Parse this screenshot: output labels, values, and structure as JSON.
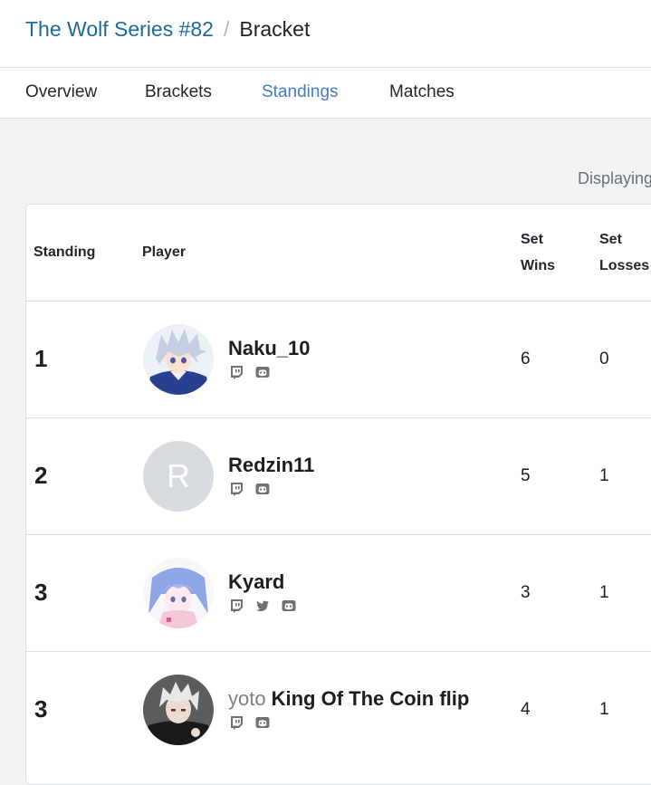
{
  "breadcrumb": {
    "tournament": "The Wolf Series #82",
    "separator": "/",
    "current": "Bracket"
  },
  "tabs": [
    {
      "label": "Overview"
    },
    {
      "label": "Brackets"
    },
    {
      "label": "Standings",
      "active": true
    },
    {
      "label": "Matches"
    }
  ],
  "displaying_text": "Displaying",
  "table": {
    "headers": {
      "standing": "Standing",
      "player": "Player",
      "set_wins_line1": "Set",
      "set_wins_line2": "Wins",
      "set_losses_line1": "Set",
      "set_losses_line2": "Losses"
    },
    "rows": [
      {
        "standing": "1",
        "prefix": "",
        "name": "Naku_10",
        "socials": [
          "twitch-icon",
          "discord-icon"
        ],
        "set_wins": "6",
        "set_losses": "0",
        "avatar": "anime-avatar-blue"
      },
      {
        "standing": "2",
        "prefix": "",
        "name": "Redzin11",
        "avatar_initial": "R",
        "socials": [
          "twitch-icon",
          "discord-icon"
        ],
        "set_wins": "5",
        "set_losses": "1",
        "avatar": "initial-avatar"
      },
      {
        "standing": "3",
        "prefix": "",
        "name": "Kyard",
        "socials": [
          "twitch-icon",
          "twitter-icon",
          "discord-icon"
        ],
        "set_wins": "3",
        "set_losses": "1",
        "avatar": "anime-avatar-pastel"
      },
      {
        "standing": "3",
        "prefix": "yoto",
        "name": "King Of The Coin flip",
        "socials": [
          "twitch-icon",
          "discord-icon"
        ],
        "set_wins": "4",
        "set_losses": "1",
        "avatar": "anime-avatar-dark"
      }
    ]
  },
  "colors": {
    "link": "#1b6c9a",
    "active_tab": "#3e80c0",
    "page_bg": "#f2f3f5",
    "icon": "#6b7178"
  }
}
